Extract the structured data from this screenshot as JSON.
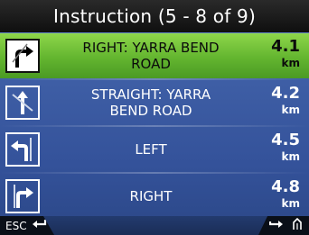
{
  "header": {
    "title": "Instruction (5 - 8 of 9)"
  },
  "instructions": [
    {
      "label_line1": "RIGHT: YARRA BEND",
      "label_line2": "ROAD",
      "distance": "4.1",
      "unit": "km",
      "icon": "turn-right-icon",
      "active": true
    },
    {
      "label_line1": "STRAIGHT: YARRA",
      "label_line2": "BEND ROAD",
      "distance": "4.2",
      "unit": "km",
      "icon": "straight-icon",
      "active": false
    },
    {
      "label_line1": "LEFT",
      "label_line2": "",
      "distance": "4.5",
      "unit": "km",
      "icon": "turn-left-icon",
      "active": false
    },
    {
      "label_line1": "RIGHT",
      "label_line2": "",
      "distance": "4.8",
      "unit": "km",
      "icon": "turn-right-icon",
      "active": false
    }
  ],
  "footer": {
    "esc_label": "ESC",
    "back_icon": "return-arrow-icon",
    "next_icon": "right-arrow-icon",
    "extra_icon": "route-icon"
  },
  "colors": {
    "active_row": "#6cc238",
    "background": "#3e5ea5",
    "title_bar": "#151515"
  }
}
